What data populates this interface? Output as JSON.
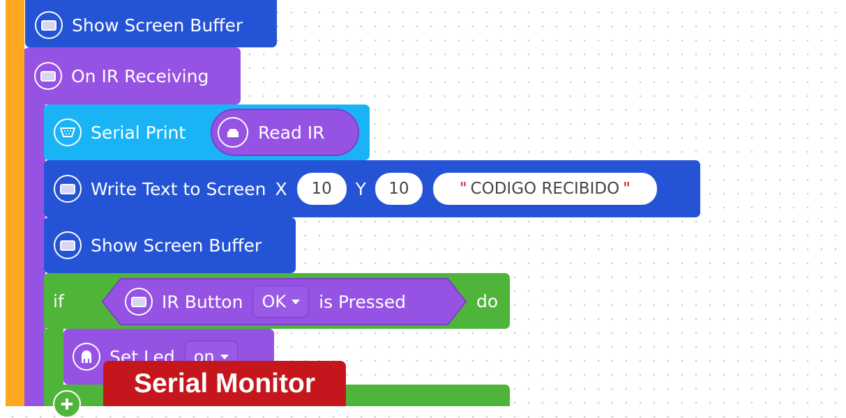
{
  "blocks": {
    "show_screen_buffer_top": "Show Screen Buffer",
    "on_ir_receiving": "On IR Receiving",
    "serial_print": "Serial Print",
    "read_ir": "Read IR",
    "write_text": "Write Text to Screen",
    "x_label": "X",
    "x_value": "10",
    "y_label": "Y",
    "y_value": "10",
    "quote_open": "\"",
    "text_value": "CODIGO RECIBIDO",
    "quote_close": "\"",
    "show_screen_buffer": "Show Screen Buffer",
    "if_label": "if",
    "ir_button": "IR Button",
    "ir_button_option": "OK",
    "is_pressed": "is Pressed",
    "do_label": "do",
    "set_led": "Set Led",
    "set_led_option": "on",
    "add_icon": "plus-icon"
  },
  "banner": {
    "text": "Serial Monitor"
  },
  "colors": {
    "orange": "#ffa81f",
    "purple": "#9653e3",
    "blue": "#2453d6",
    "cyan": "#1ab4f6",
    "green": "#4fb53a",
    "banner_red": "#c4161c"
  }
}
